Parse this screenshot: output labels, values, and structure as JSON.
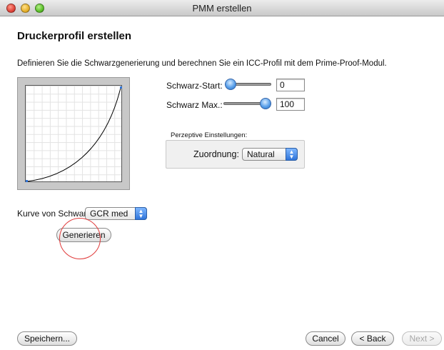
{
  "window": {
    "title": "PMM erstellen"
  },
  "page": {
    "title": "Druckerprofil erstellen",
    "description": "Definieren Sie die Schwarzgenerierung und berechnen Sie ein ICC-Profil mit dem Prime-Proof-Modul."
  },
  "controls": {
    "schwarz_start_label": "Schwarz-Start:",
    "schwarz_start_value": "0",
    "schwarz_start_slider_level": 0,
    "schwarz_max_label": "Schwarz Max.:",
    "schwarz_max_value": "100",
    "schwarz_max_slider_level": 1,
    "perceptive_group_title": "Perzeptive Einstellungen:",
    "zuordnung_label": "Zuordnung:",
    "zuordnung_value": "Natural",
    "kurve_label": "Kurve von Schwar",
    "kurve_value": "GCR med",
    "generate_button": "Generieren"
  },
  "footer": {
    "save_button": "Speichern...",
    "cancel_button": "Cancel",
    "back_button": "< Back",
    "next_button": "Next >"
  },
  "colors": {
    "accent": "#2f74d9",
    "highlight_circle": "#e03a3a"
  }
}
